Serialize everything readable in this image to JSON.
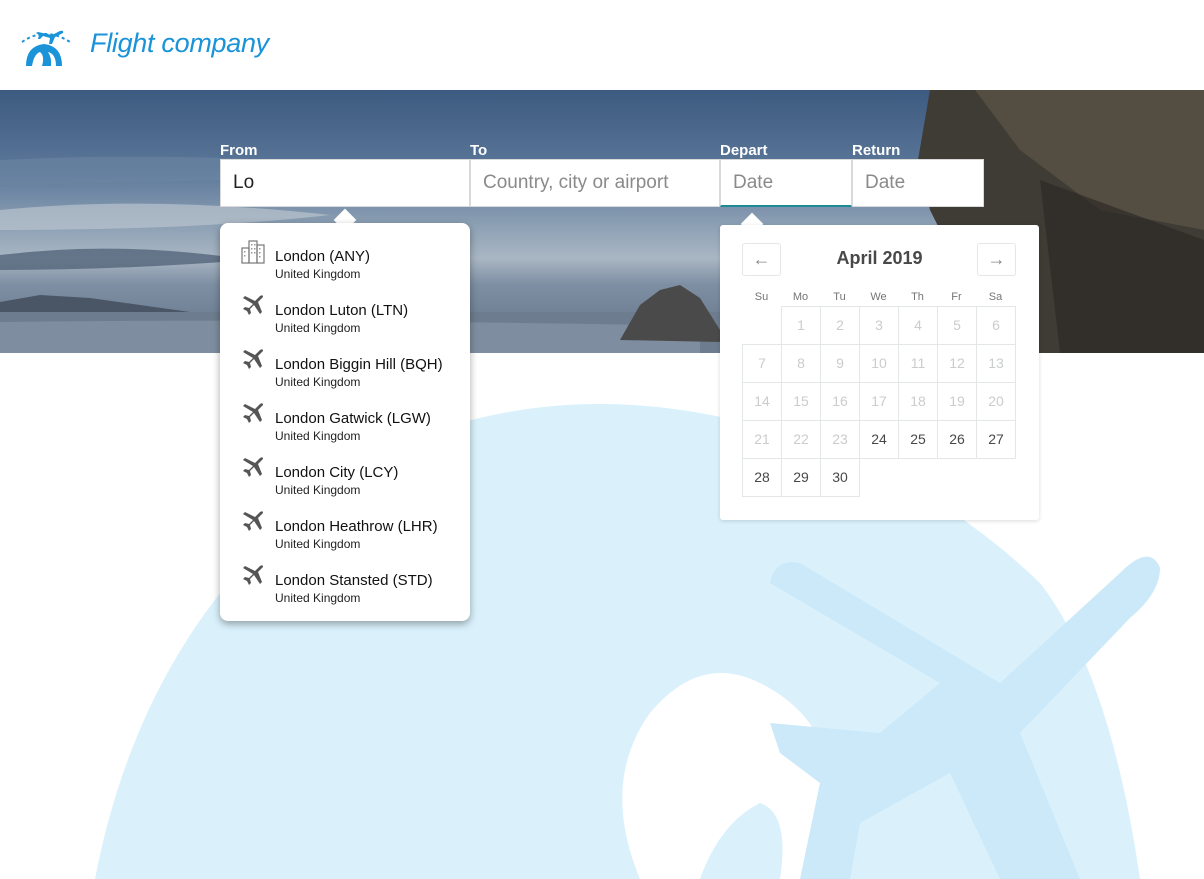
{
  "brand": {
    "name": "Flight company",
    "color": "#1a93d9",
    "logo_icon": "plane-globe-icon"
  },
  "search": {
    "from": {
      "label": "From",
      "value": "Lo"
    },
    "to": {
      "label": "To",
      "placeholder": "Country, city or airport"
    },
    "depart": {
      "label": "Depart",
      "placeholder": "Date"
    },
    "return": {
      "label": "Return",
      "placeholder": "Date"
    }
  },
  "suggestions": [
    {
      "name": "London (ANY)",
      "country": "United Kingdom",
      "icon": "city-icon"
    },
    {
      "name": "London Luton (LTN)",
      "country": "United Kingdom",
      "icon": "airplane-icon"
    },
    {
      "name": "London Biggin Hill (BQH)",
      "country": "United Kingdom",
      "icon": "airplane-icon"
    },
    {
      "name": "London Gatwick (LGW)",
      "country": "United Kingdom",
      "icon": "airplane-icon"
    },
    {
      "name": "London City (LCY)",
      "country": "United Kingdom",
      "icon": "airplane-icon"
    },
    {
      "name": "London Heathrow (LHR)",
      "country": "United Kingdom",
      "icon": "airplane-icon"
    },
    {
      "name": "London Stansted (STD)",
      "country": "United Kingdom",
      "icon": "airplane-icon"
    }
  ],
  "calendar": {
    "month_label": "April 2019",
    "prev_icon": "arrow-left-icon",
    "next_icon": "arrow-right-icon",
    "prev_glyph": "←",
    "next_glyph": "→",
    "weekdays": [
      "Su",
      "Mo",
      "Tu",
      "We",
      "Th",
      "Fr",
      "Sa"
    ],
    "first_weekday_index": 1,
    "days_in_month": 30,
    "first_available_day": 24
  }
}
